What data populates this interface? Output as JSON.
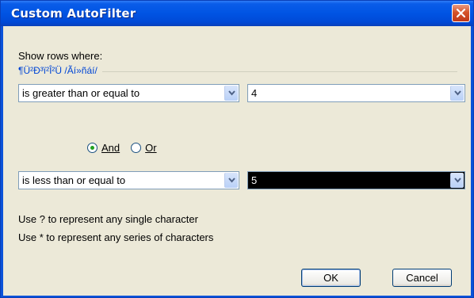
{
  "window": {
    "title": "Custom AutoFilter"
  },
  "dialog": {
    "show_rows_label": "Show rows where:",
    "group_caption": "¶Ü²Ð³ï²Î²Ü /Ãí»ñáí/",
    "row1": {
      "operator": "is greater than or equal to",
      "value": "4"
    },
    "logic": {
      "and_label": "And",
      "or_label": "Or",
      "selected": "And"
    },
    "row2": {
      "operator": "is less than or equal to",
      "value": "5"
    },
    "hint_single": "Use ? to represent any single character",
    "hint_series": "Use * to represent any series of characters",
    "ok_label": "OK",
    "cancel_label": "Cancel"
  },
  "icons": {
    "close": "close-icon",
    "dropdown": "chevron-down-icon"
  }
}
